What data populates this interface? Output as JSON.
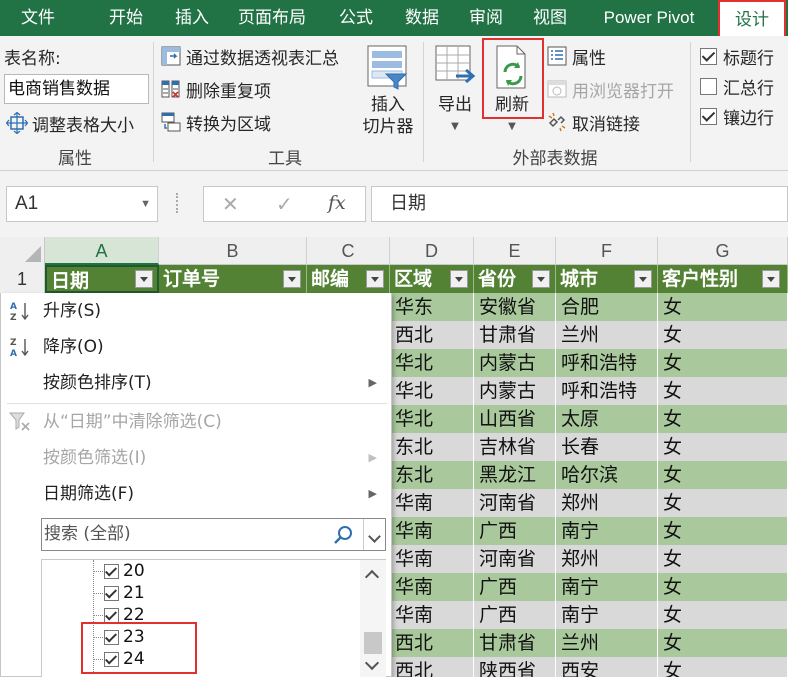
{
  "tabs": [
    "文件",
    "开始",
    "插入",
    "页面布局",
    "公式",
    "数据",
    "审阅",
    "视图",
    "Power Pivot",
    "设计"
  ],
  "active_tab": "设计",
  "ribbon": {
    "table_name_label": "表名称:",
    "table_name_value": "电商销售数据",
    "resize_table": "调整表格大小",
    "group_properties": "属性",
    "summarize_pivot": "通过数据透视表汇总",
    "remove_duplicates": "删除重复项",
    "convert_to_range": "转换为区域",
    "group_tools": "工具",
    "insert_slicer": [
      "插入",
      "切片器"
    ],
    "export": "导出",
    "refresh": "刷新",
    "properties": "属性",
    "open_in_browser": "用浏览器打开",
    "unlink": "取消链接",
    "group_external": "外部表数据",
    "header_row": "标题行",
    "total_row": "汇总行",
    "banded_rows": "镶边行"
  },
  "formula_bar": {
    "name_box": "A1",
    "cancel": "✕",
    "enter": "✓",
    "fx": "fx",
    "formula": "日期"
  },
  "columns": [
    "A",
    "B",
    "C",
    "D",
    "E",
    "F",
    "G"
  ],
  "row_number": "1",
  "table_headers": [
    "日期",
    "订单号",
    "邮编",
    "区域",
    "省份",
    "城市",
    "客户性别"
  ],
  "rows": [
    [
      "华东",
      "安徽省",
      "合肥",
      "女"
    ],
    [
      "西北",
      "甘肃省",
      "兰州",
      "女"
    ],
    [
      "华北",
      "内蒙古",
      "呼和浩特",
      "女"
    ],
    [
      "华北",
      "内蒙古",
      "呼和浩特",
      "女"
    ],
    [
      "华北",
      "山西省",
      "太原",
      "女"
    ],
    [
      "东北",
      "吉林省",
      "长春",
      "女"
    ],
    [
      "东北",
      "黑龙江",
      "哈尔滨",
      "女"
    ],
    [
      "华南",
      "河南省",
      "郑州",
      "女"
    ],
    [
      "华南",
      "广西",
      "南宁",
      "女"
    ],
    [
      "华南",
      "河南省",
      "郑州",
      "女"
    ],
    [
      "华南",
      "广西",
      "南宁",
      "女"
    ],
    [
      "华南",
      "广西",
      "南宁",
      "女"
    ],
    [
      "西北",
      "甘肃省",
      "兰州",
      "女"
    ],
    [
      "西北",
      "陕西省",
      "西安",
      "女"
    ]
  ],
  "filter_menu": {
    "sort_asc": "升序(S)",
    "sort_desc": "降序(O)",
    "sort_by_color": "按颜色排序(T)",
    "clear_filter": "从“日期”中清除筛选(C)",
    "filter_by_color": "按颜色筛选(I)",
    "date_filters": "日期筛选(F)",
    "search_placeholder": "搜索 (全部)",
    "tree_items": [
      "20",
      "21",
      "22",
      "23",
      "24"
    ]
  },
  "colors": {
    "ribbon_tab_bg": "#217346",
    "table_header_bg": "#548235",
    "band_light": "#a9c99c",
    "band_gray": "#d9d9d9",
    "highlight": "#e03030"
  }
}
